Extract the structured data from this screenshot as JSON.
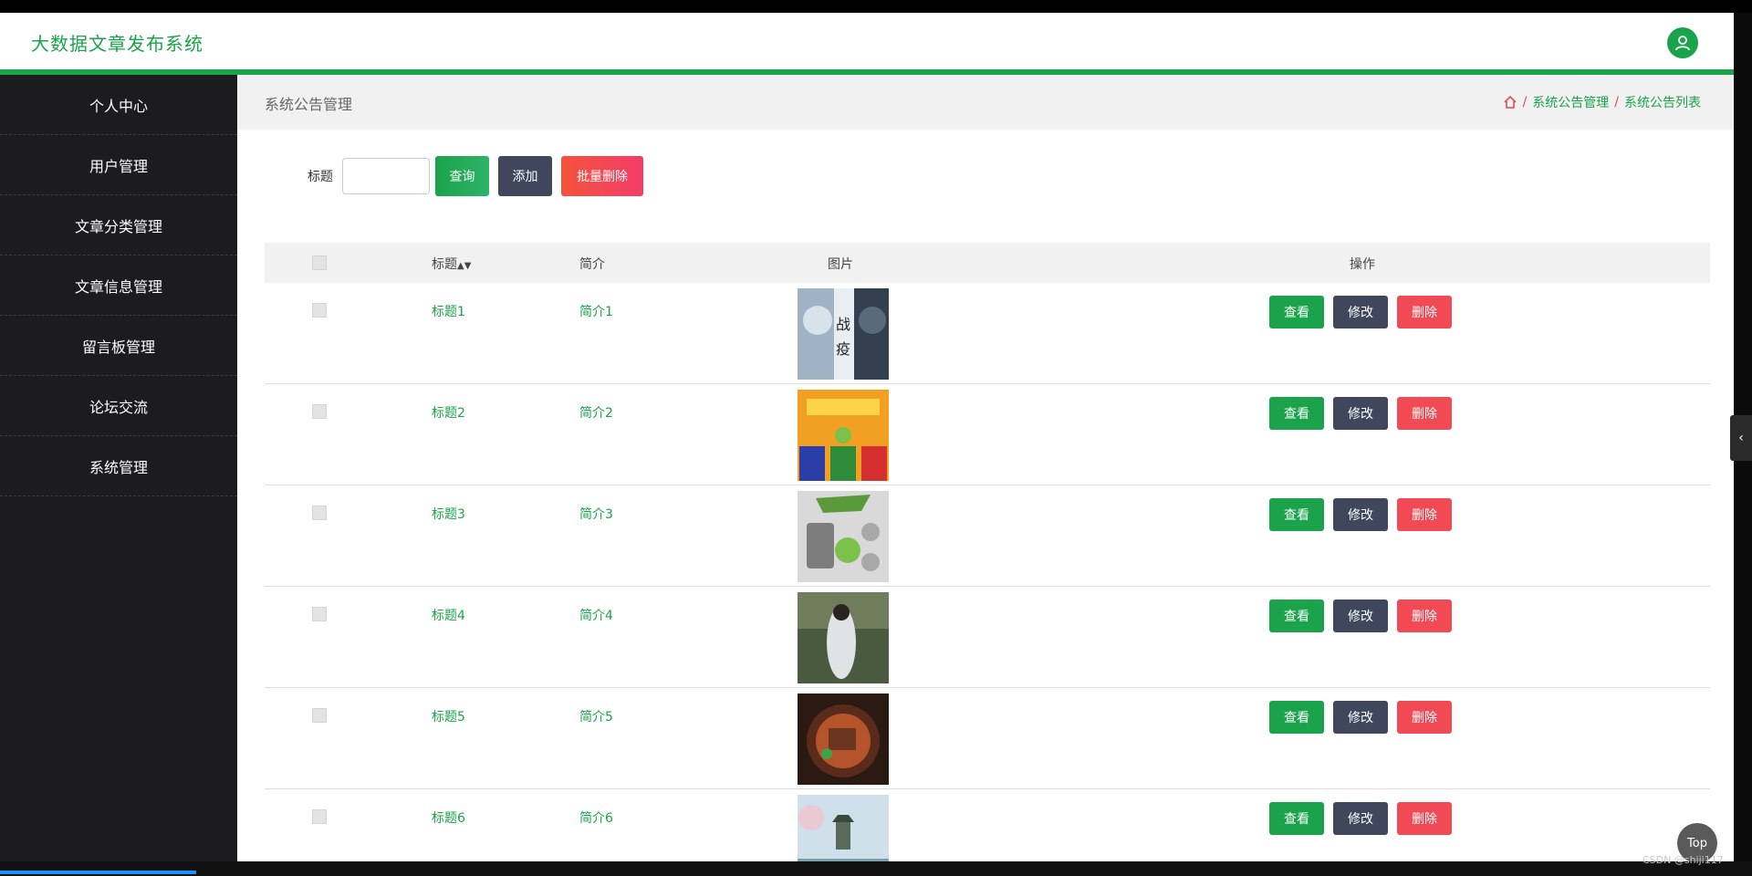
{
  "app": {
    "title": "大数据文章发布系统"
  },
  "sidebar": {
    "items": [
      {
        "label": "个人中心"
      },
      {
        "label": "用户管理"
      },
      {
        "label": "文章分类管理"
      },
      {
        "label": "文章信息管理"
      },
      {
        "label": "留言板管理"
      },
      {
        "label": "论坛交流"
      },
      {
        "label": "系统管理"
      }
    ]
  },
  "page": {
    "heading": "系统公告管理",
    "breadcrumb": [
      "系统公告管理",
      "系统公告列表"
    ],
    "breadcrumb_sep": "/"
  },
  "search": {
    "label": "标题",
    "value": "",
    "query_label": "查询",
    "add_label": "添加",
    "batch_delete_label": "批量删除"
  },
  "table": {
    "headers": {
      "title": "标题",
      "intro": "简介",
      "image": "图片",
      "actions": "操作"
    },
    "rows": [
      {
        "title": "标题1",
        "intro": "简介1"
      },
      {
        "title": "标题2",
        "intro": "简介2"
      },
      {
        "title": "标题3",
        "intro": "简介3"
      },
      {
        "title": "标题4",
        "intro": "简介4"
      },
      {
        "title": "标题5",
        "intro": "简介5"
      },
      {
        "title": "标题6",
        "intro": "简介6"
      }
    ],
    "actions": {
      "view": "查看",
      "edit": "修改",
      "delete": "删除"
    }
  },
  "widgets": {
    "top_label": "Top",
    "watermark": "CSDN @shiji117"
  },
  "colors": {
    "accent": "#1aa34a",
    "sidebar_bg": "#1c1c1e",
    "danger": "#f14a55",
    "dark_button": "#40465c"
  }
}
